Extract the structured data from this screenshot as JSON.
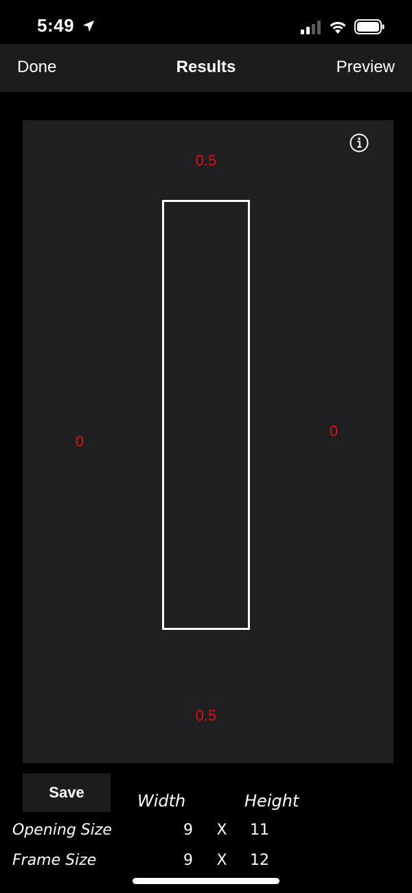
{
  "status_bar": {
    "time": "5:49",
    "icons": [
      "location-arrow-icon",
      "cellular-signal-icon",
      "wifi-icon",
      "battery-icon"
    ]
  },
  "nav": {
    "done_label": "Done",
    "title": "Results",
    "preview_label": "Preview"
  },
  "canvas": {
    "info_icon": "info-icon",
    "measure_top": "0.5",
    "measure_bottom": "0.5",
    "measure_left": "0",
    "measure_right": "0",
    "measure_color": "#e01010",
    "frame_stroke_color": "#ffffff"
  },
  "bottom": {
    "save_label": "Save",
    "col_width": "Width",
    "col_height": "Height",
    "rows": [
      {
        "label": "Opening Size",
        "width": "9",
        "x": "X",
        "height": "11"
      },
      {
        "label": "Frame Size",
        "width": "9",
        "x": "X",
        "height": "12"
      }
    ]
  },
  "colors": {
    "background": "#000000",
    "bar": "#1c1c1e",
    "panel": "#1f1f21",
    "accent_red": "#e01010"
  }
}
